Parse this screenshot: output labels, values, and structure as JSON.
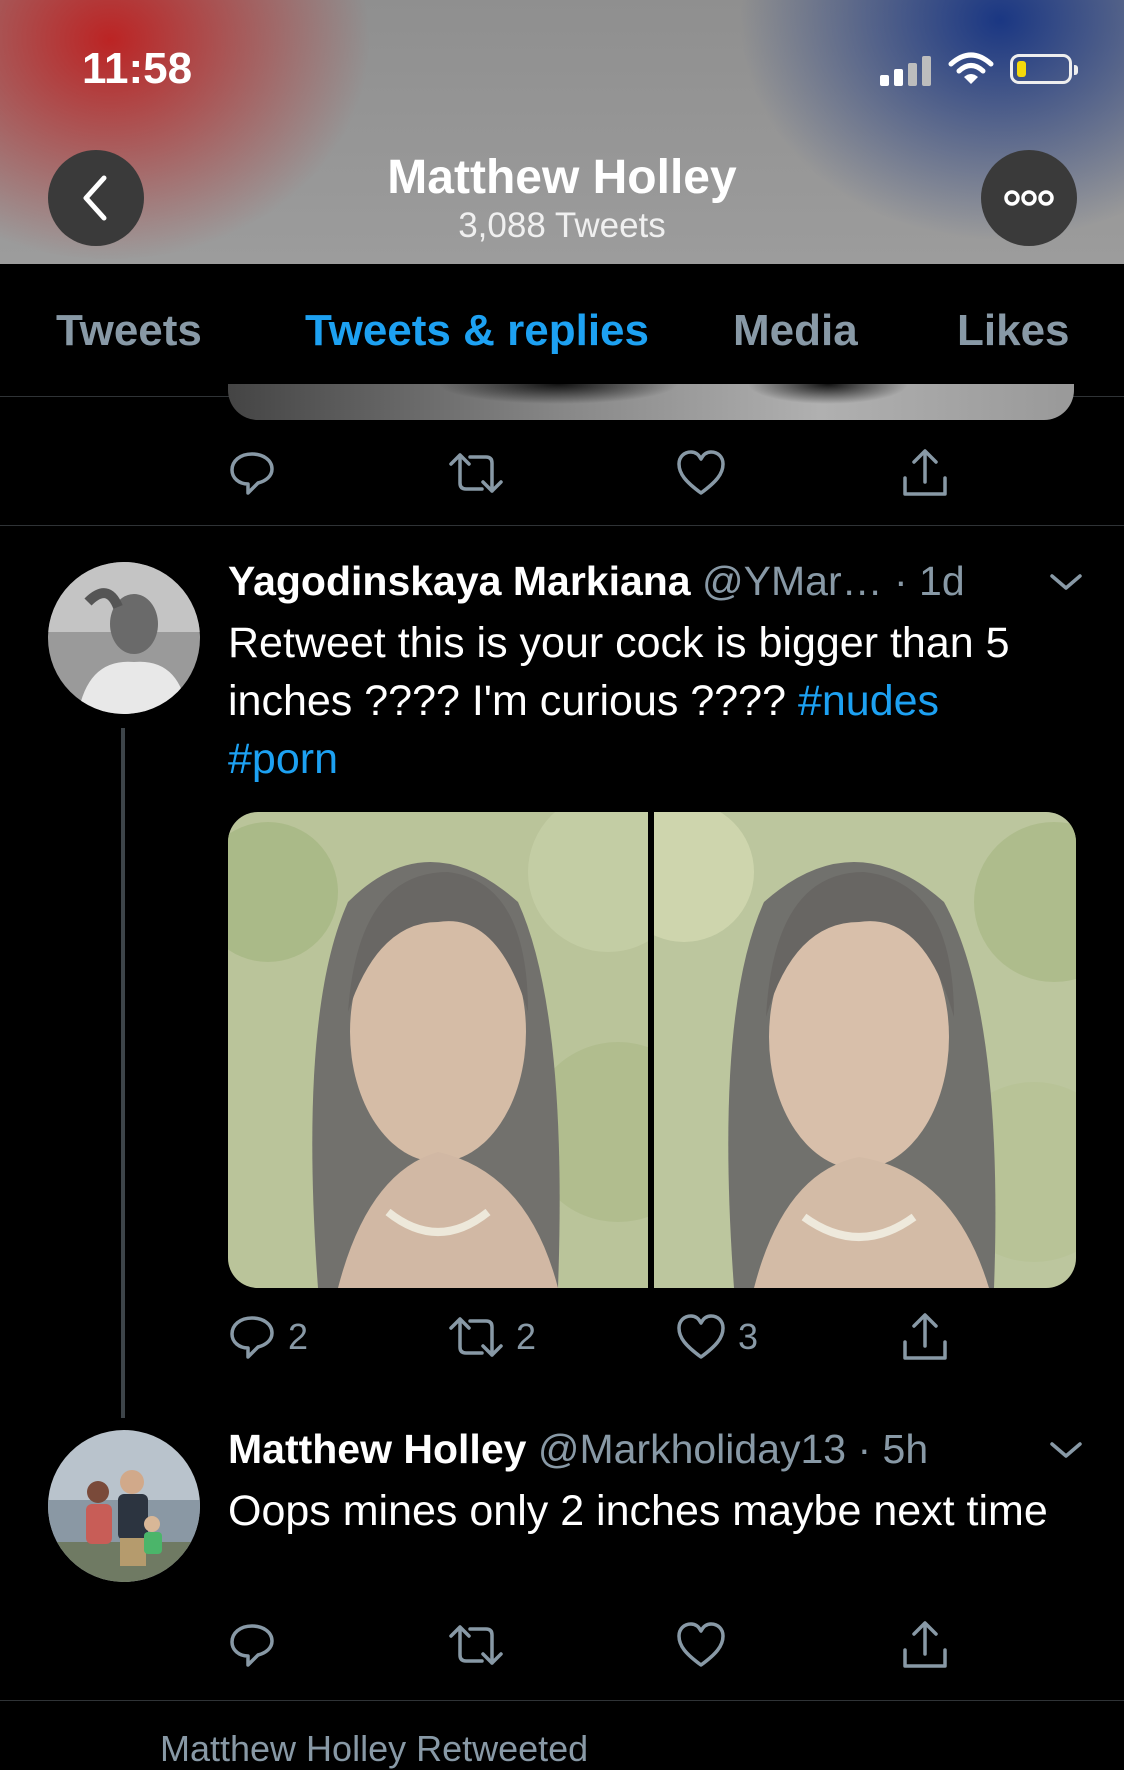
{
  "status_bar": {
    "time": "11:58"
  },
  "header": {
    "name": "Matthew Holley",
    "tweet_count": "3,088 Tweets"
  },
  "tabs": [
    {
      "label": "Tweets",
      "active": false
    },
    {
      "label": "Tweets & replies",
      "active": true
    },
    {
      "label": "Media",
      "active": false
    },
    {
      "label": "Likes",
      "active": false
    }
  ],
  "icons": {
    "reply": "reply-icon",
    "retweet": "retweet-icon",
    "like": "like-icon",
    "share": "share-icon"
  },
  "colors": {
    "accent": "#1da1f2",
    "muted": "#8899a6",
    "background": "#000000"
  },
  "tweets": [
    {
      "display_name": "Yagodinskaya Markiana",
      "handle_time": "@YMar… · 1d",
      "text": "Retweet this is your cock is bigger than 5 inches ???? I'm curious ???? ",
      "hashtags": [
        "#nudes",
        "#porn"
      ],
      "reply_count": "2",
      "retweet_count": "2",
      "like_count": "3"
    },
    {
      "display_name": "Matthew Holley",
      "handle_time": "@Markholiday13 · 5h",
      "text": "Oops mines only 2 inches maybe next time"
    }
  ],
  "partial_footer": "Matthew Holley Retweeted"
}
